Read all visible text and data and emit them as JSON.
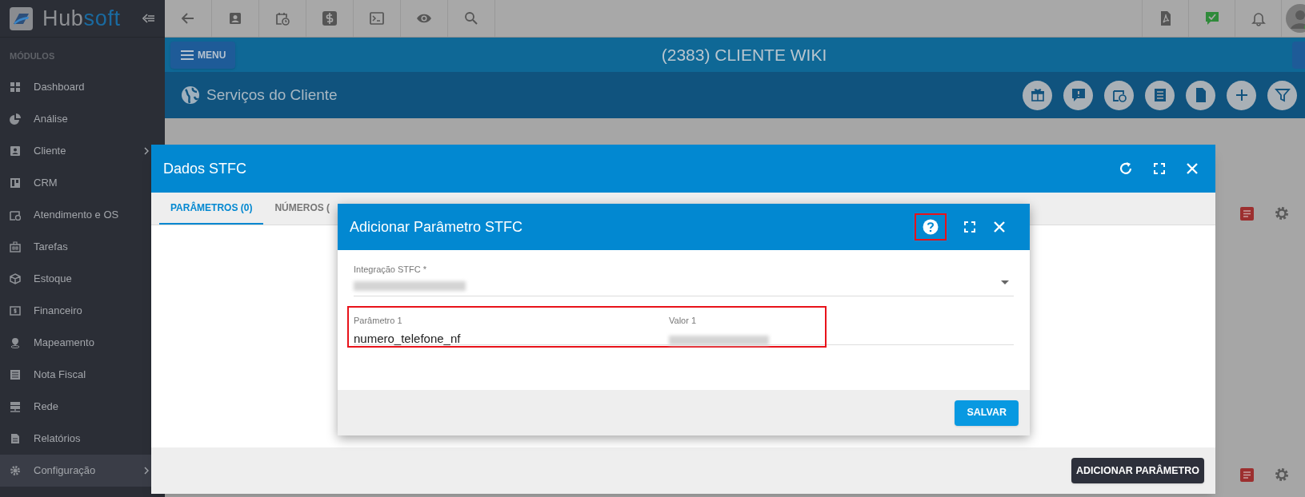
{
  "logo": {
    "text": "Hub",
    "accent": "soft"
  },
  "sidebar": {
    "section": "MÓDULOS",
    "items": [
      {
        "label": "Dashboard",
        "expandable": false,
        "selected": false
      },
      {
        "label": "Análise",
        "expandable": false,
        "selected": false
      },
      {
        "label": "Cliente",
        "expandable": true,
        "selected": false
      },
      {
        "label": "CRM",
        "expandable": false,
        "selected": false
      },
      {
        "label": "Atendimento e OS",
        "expandable": false,
        "selected": false
      },
      {
        "label": "Tarefas",
        "expandable": false,
        "selected": false
      },
      {
        "label": "Estoque",
        "expandable": false,
        "selected": false
      },
      {
        "label": "Financeiro",
        "expandable": false,
        "selected": false
      },
      {
        "label": "Mapeamento",
        "expandable": false,
        "selected": false
      },
      {
        "label": "Nota Fiscal",
        "expandable": false,
        "selected": false
      },
      {
        "label": "Rede",
        "expandable": false,
        "selected": false
      },
      {
        "label": "Relatórios",
        "expandable": false,
        "selected": false
      },
      {
        "label": "Configuração",
        "expandable": true,
        "selected": true
      }
    ]
  },
  "page_header": {
    "menu_button": "MENU",
    "title": "(2383) CLIENTE WIKI",
    "section_title": "Serviços do Cliente"
  },
  "dialog": {
    "title": "Dados STFC",
    "tabs": [
      {
        "label": "PARÂMETROS (0)",
        "selected": true
      },
      {
        "label": "NÚMEROS (",
        "selected": false
      }
    ],
    "footer_button": "ADICIONAR PARÂMETRO"
  },
  "subdialog": {
    "title": "Adicionar Parâmetro STFC",
    "help_highlighted": true,
    "select_field": {
      "label": "Integração STFC *"
    },
    "parameter_row": {
      "highlighted": true,
      "fields": [
        {
          "label": "Parâmetro 1",
          "value": "numero_telefone_nf"
        },
        {
          "label": "Valor 1"
        }
      ]
    },
    "save_button": "SALVAR"
  }
}
